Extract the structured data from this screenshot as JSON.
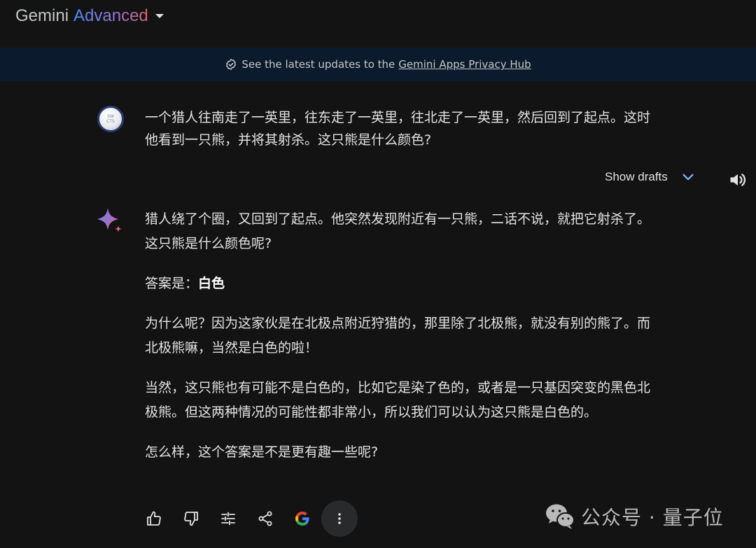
{
  "header": {
    "brand_name": "Gemini",
    "brand_tier": "Advanced"
  },
  "banner": {
    "text": "See the latest updates to the",
    "link_text": "Gemini Apps Privacy Hub"
  },
  "user": {
    "avatar_line1": "SW",
    "avatar_line2": "CTS"
  },
  "prompt": {
    "line1": "一个猎人往南走了一英里，往东走了一英里，往北走了一英里，然后回到了起点。这时",
    "line2": "他看到一只熊，并将其射杀。这只熊是什么颜色?"
  },
  "drafts": {
    "label": "Show drafts"
  },
  "response": {
    "p1_line1": "猎人绕了个圈，又回到了起点。他突然发现附近有一只熊，二话不说，就把它射杀了。",
    "p1_line2": "这只熊是什么颜色呢?",
    "p2_prefix": "答案是：",
    "p2_bold": "白色",
    "p3_line1": "为什么呢？因为这家伙是在北极点附近狩猎的，那里除了北极熊，就没有别的熊了。而",
    "p3_line2": "北极熊嘛，当然是白色的啦！",
    "p4_line1": "当然，这只熊也有可能不是白色的，比如它是染了色的，或者是一只基因突变的黑色北",
    "p4_line2": "极熊。但这两种情况的可能性都非常小，所以我们可以认为这只熊是白色的。",
    "p5": "怎么样，这个答案是不是更有趣一些呢?"
  },
  "actions": [
    "thumb-up-icon",
    "thumb-down-icon",
    "modify-response-icon",
    "share-icon",
    "google-icon",
    "more-vert-icon"
  ],
  "watermark": {
    "text": "公众号 · 量子位"
  },
  "colors": {
    "background": "#131314",
    "banner": "#0c1a2e",
    "accent_blue": "#8ab4f8",
    "sparkle_blue": "#4f8df5",
    "sparkle_red": "#d96570"
  }
}
